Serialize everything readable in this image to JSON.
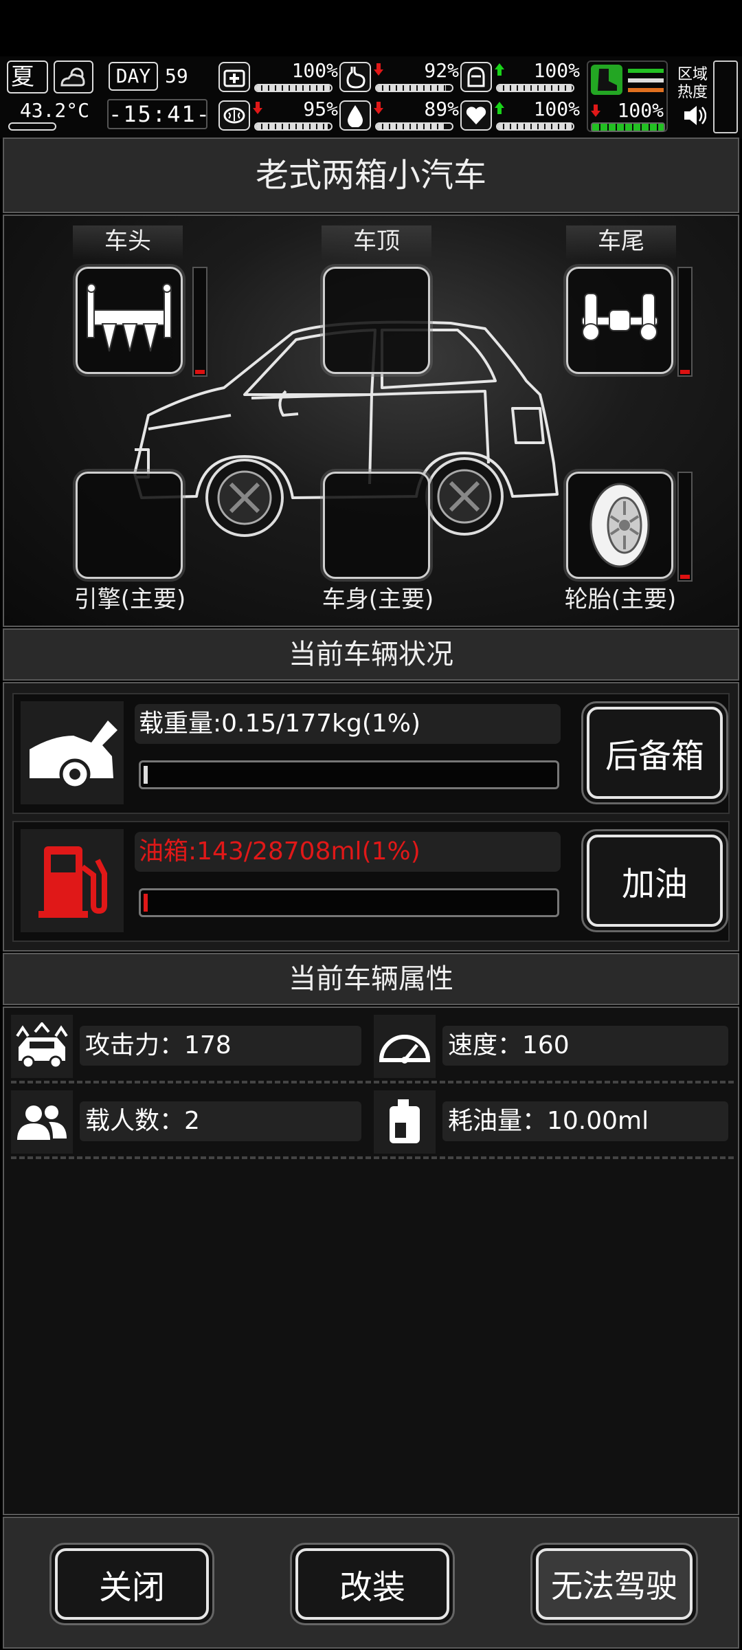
{
  "hud": {
    "season": "夏",
    "temperature": "43.2°C",
    "day_label": "DAY",
    "day_number": "59",
    "clock": "-15:41-",
    "stats": [
      {
        "name": "health",
        "value": "100%",
        "trend": "none",
        "fill": 1.0
      },
      {
        "name": "hunger",
        "value": "92%",
        "trend": "down",
        "fill": 0.92
      },
      {
        "name": "armor",
        "value": "100%",
        "trend": "up",
        "fill": 1.0
      },
      {
        "name": "brain",
        "value": "95%",
        "trend": "down",
        "fill": 0.95
      },
      {
        "name": "water",
        "value": "89%",
        "trend": "down",
        "fill": 0.89
      },
      {
        "name": "heart",
        "value": "100%",
        "trend": "up",
        "fill": 1.0
      }
    ],
    "stamina": {
      "value": "100%",
      "trend": "down",
      "fill": 1.0
    },
    "zone_label": "区域热度"
  },
  "title": "老式两箱小汽车",
  "slots": {
    "front": "车头",
    "roof": "车顶",
    "rear": "车尾",
    "engine": "引擎(主要)",
    "body": "车身(主要)",
    "tires": "轮胎(主要)"
  },
  "status": {
    "heading": "当前车辆状况",
    "cargo": {
      "text": "载重量:0.15/177kg(1%)",
      "fill": 0.01,
      "button": "后备箱"
    },
    "fuel": {
      "text": "油箱:143/28708ml(1%)",
      "fill": 0.01,
      "button": "加油",
      "color": "#e01818"
    }
  },
  "attributes": {
    "heading": "当前车辆属性",
    "attack": "攻击力：178",
    "speed": "速度：160",
    "passengers": "载人数：2",
    "fuel_use": "耗油量：10.00ml"
  },
  "footer": {
    "close": "关闭",
    "modify": "改装",
    "drive": "无法驾驶"
  },
  "colors": {
    "accent_red": "#e01818",
    "arrow_up": "#19d419",
    "arrow_down": "#e01818",
    "stamina_green": "#22c022"
  }
}
